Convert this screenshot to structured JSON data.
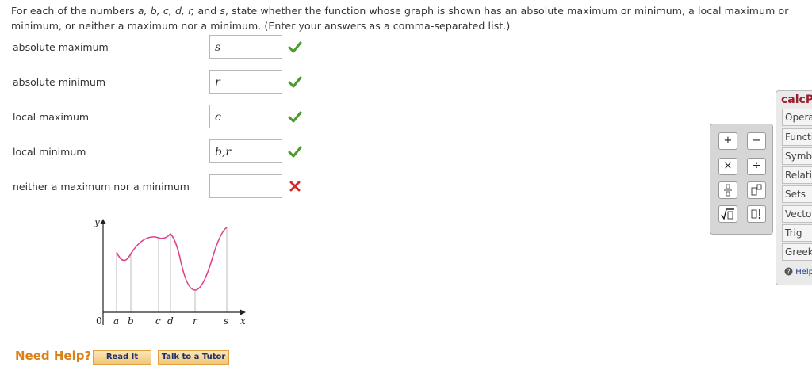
{
  "question": {
    "pre": "For each of the numbers ",
    "vars": "a, b, c, d, r,",
    "and": " and ",
    "svar": "s",
    "post": ", state whether the function whose graph is shown has an absolute maximum or minimum, a local maximum or minimum, or neither a maximum nor a minimum. (Enter your answers as a comma-separated list.)"
  },
  "rows": [
    {
      "label": "absolute maximum",
      "answer": "s",
      "status": "correct"
    },
    {
      "label": "absolute minimum",
      "answer": "r",
      "status": "correct"
    },
    {
      "label": "local maximum",
      "answer": "c",
      "status": "correct"
    },
    {
      "label": "local minimum",
      "answer": "b,r",
      "status": "correct"
    },
    {
      "label": "neither a maximum nor a minimum",
      "answer": "",
      "status": "incorrect"
    }
  ],
  "graph": {
    "y_label": "y",
    "x_label": "x",
    "origin": "0",
    "ticks": [
      "a",
      "b",
      "c",
      "d",
      "r",
      "s"
    ],
    "curve_color": "#e0408a"
  },
  "help": {
    "title": "Need Help?",
    "read_it": "Read It",
    "tutor": "Talk to a Tutor"
  },
  "calc": {
    "keys": [
      "+",
      "−",
      "×",
      "÷",
      "fraction",
      "power",
      "sqrt",
      "factorial"
    ],
    "title": "calcP",
    "tabs": [
      "Operat",
      "Functi",
      "Symbo",
      "Relatio",
      "Sets",
      "Vector",
      "Trig",
      "Greek"
    ],
    "help": "Help"
  },
  "colors": {
    "correct": "#4a9b2a",
    "incorrect": "#d22a2a",
    "accent": "#d9821b"
  }
}
